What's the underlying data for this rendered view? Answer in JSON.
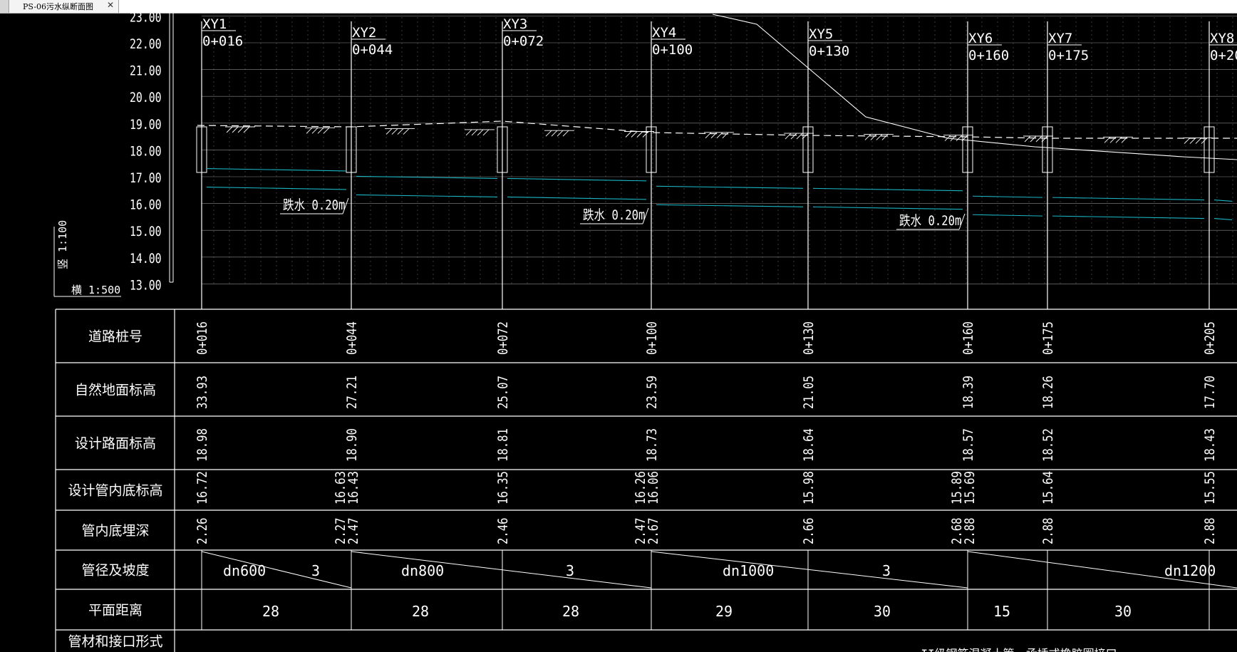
{
  "tab": {
    "title": "PS-06污水纵断面图",
    "close": "✕"
  },
  "colors": {
    "background": "#000000",
    "line": "#ffffff",
    "pipe": "#19b5c3",
    "grid": "#8a8a8a"
  },
  "elevation_ticks": [
    "23.00",
    "22.00",
    "21.00",
    "20.00",
    "19.00",
    "18.00",
    "17.00",
    "16.00",
    "15.00",
    "14.00",
    "13.00"
  ],
  "scale": {
    "vertical": "竖 1:100",
    "horizontal": "横 1:500"
  },
  "manholes": [
    {
      "id": "XY1",
      "chainage": "0+016",
      "natural": "33.93",
      "road": "18.98",
      "inverts": [
        "16.72"
      ],
      "depths": [
        "2.26"
      ]
    },
    {
      "id": "XY2",
      "chainage": "0+044",
      "natural": "27.21",
      "road": "18.90",
      "inverts": [
        "16.63",
        "16.43"
      ],
      "depths": [
        "2.27",
        "2.47"
      ]
    },
    {
      "id": "XY3",
      "chainage": "0+072",
      "natural": "25.07",
      "road": "18.81",
      "inverts": [
        "16.35"
      ],
      "depths": [
        "2.46"
      ]
    },
    {
      "id": "XY4",
      "chainage": "0+100",
      "natural": "23.59",
      "road": "18.73",
      "inverts": [
        "16.26",
        "16.06"
      ],
      "depths": [
        "2.47",
        "2.67"
      ]
    },
    {
      "id": "XY5",
      "chainage": "0+130",
      "natural": "21.05",
      "road": "18.64",
      "inverts": [
        "15.98"
      ],
      "depths": [
        "2.66"
      ]
    },
    {
      "id": "XY6",
      "chainage": "0+160",
      "natural": "18.39",
      "road": "18.57",
      "inverts": [
        "15.89",
        "15.69"
      ],
      "depths": [
        "2.68",
        "2.88"
      ]
    },
    {
      "id": "XY7",
      "chainage": "0+175",
      "natural": "18.26",
      "road": "18.52",
      "inverts": [
        "15.64"
      ],
      "depths": [
        "2.88"
      ]
    },
    {
      "id": "XY8",
      "chainage": "0+205",
      "natural": "17.70",
      "road": "18.43",
      "inverts": [
        "15.55"
      ],
      "depths": [
        "2.88"
      ]
    }
  ],
  "drops": [
    "跌水 0.20m",
    "跌水 0.20m",
    "跌水 0.20m"
  ],
  "row_labels": [
    "道路桩号",
    "自然地面标高",
    "设计路面标高",
    "设计管内底标高",
    "管内底埋深",
    "管径及坡度",
    "平面距离",
    "管材和接口形式"
  ],
  "pipes": [
    {
      "dn": "dn600",
      "slope": "3"
    },
    {
      "dn": "dn800",
      "slope": "3"
    },
    {
      "dn": "dn1000",
      "slope": "3"
    },
    {
      "dn": "dn1200",
      "slope": ""
    }
  ],
  "distances": [
    "28",
    "28",
    "28",
    "29",
    "30",
    "15",
    "30"
  ],
  "material": "II级钢筋混凝土管，承插式橡胶圈接口"
}
